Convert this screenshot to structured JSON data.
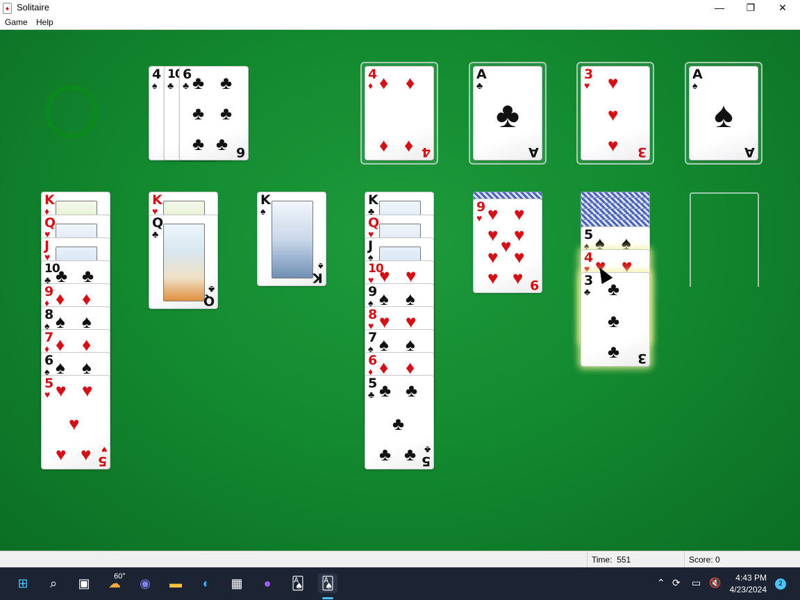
{
  "window": {
    "title": "Solitaire",
    "minimize": "—",
    "maximize": "❐",
    "close": "✕"
  },
  "menu": {
    "game": "Game",
    "help": "Help"
  },
  "status": {
    "time_label": "Time:",
    "time_value": "551",
    "score_label": "Score:",
    "score_value": "0"
  },
  "cards": {
    "waste": [
      {
        "rank": "4",
        "suit": "♠"
      },
      {
        "rank": "10",
        "suit": "♣"
      },
      {
        "rank": "6",
        "suit": "♣"
      }
    ],
    "foundations": [
      {
        "rank": "4",
        "suit": "♦"
      },
      {
        "rank": "A",
        "suit": "♣"
      },
      {
        "rank": "3",
        "suit": "♥"
      },
      {
        "rank": "A",
        "suit": "♠"
      }
    ],
    "tableau1": [
      "K",
      "Q",
      "J",
      "10",
      "9",
      "8",
      "7",
      "6",
      "5"
    ],
    "tableau1_suits": [
      "♦",
      "♥",
      "♥",
      "♣",
      "♦",
      "♠",
      "♦",
      "♠",
      "♥"
    ],
    "tableau2": [
      "K",
      "Q"
    ],
    "tableau2_suits": [
      "♥",
      "♣"
    ],
    "tableau3": {
      "rank": "K",
      "suit": "♠"
    },
    "tableau4": [
      "K",
      "Q",
      "J",
      "10",
      "9",
      "8",
      "7",
      "6",
      "5"
    ],
    "tableau4_suits": [
      "♣",
      "♥",
      "♠",
      "♥",
      "♠",
      "♥",
      "♠",
      "♦",
      "♣"
    ],
    "tableau5": {
      "rank": "9",
      "suit": "♥"
    },
    "tableau6": [
      "5",
      "4",
      "3"
    ],
    "tableau6_suits": [
      "♠",
      "♥",
      "♣"
    ]
  },
  "taskbar": {
    "weather": "60°",
    "time": "4:43 PM",
    "date": "4/23/2024",
    "notifications": "2",
    "icons": [
      "start-icon",
      "search-icon",
      "task-view-icon",
      "weather-icon",
      "chat-icon",
      "file-explorer-icon",
      "edge-icon",
      "store-icon",
      "firefox-icon",
      "solitaire-icon",
      "solitaire-active-icon"
    ]
  },
  "colors": {
    "felt": "#138a30",
    "red_suit": "#d31016",
    "black_suit": "#111111",
    "taskbar": "#1c2333"
  }
}
